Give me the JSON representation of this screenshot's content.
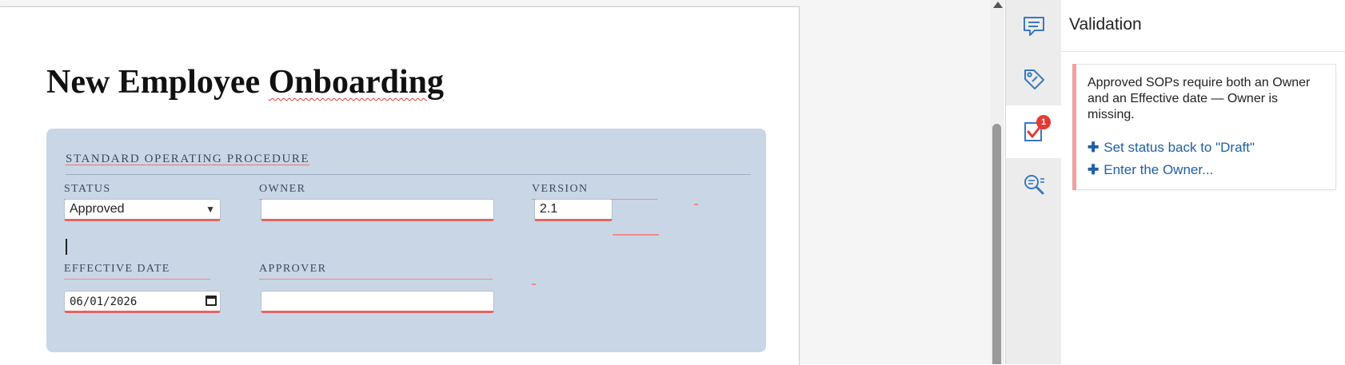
{
  "document": {
    "title_part1": "New Employee ",
    "title_part2": "Onboarding"
  },
  "sop": {
    "heading": "STANDARD OPERATING PROCEDURE",
    "fields": {
      "status": {
        "label": "STATUS",
        "value": "Approved"
      },
      "owner": {
        "label": "OWNER",
        "value": ""
      },
      "version": {
        "label": "VERSION",
        "value": "2.1"
      },
      "effective_date": {
        "label": "EFFECTIVE DATE",
        "value": "06/01/2026"
      },
      "approver": {
        "label": "APPROVER",
        "value": ""
      }
    }
  },
  "toolstrip": {
    "items": [
      {
        "name": "comments",
        "icon": "comment-icon",
        "active": false
      },
      {
        "name": "tags",
        "icon": "tag-icon",
        "active": false
      },
      {
        "name": "validation",
        "icon": "checklist-icon",
        "active": true,
        "badge": "1"
      },
      {
        "name": "search",
        "icon": "search-icon",
        "active": false
      }
    ]
  },
  "validation_panel": {
    "title": "Validation",
    "message": "Approved SOPs require both an Owner and an Effective date — Owner is missing.",
    "actions": [
      {
        "label": "Set status back to \"Draft\""
      },
      {
        "label": "Enter the Owner..."
      }
    ]
  },
  "colors": {
    "accent_link": "#1f5fa8",
    "error": "#e53935",
    "panel_bg": "#c9d6e6"
  }
}
